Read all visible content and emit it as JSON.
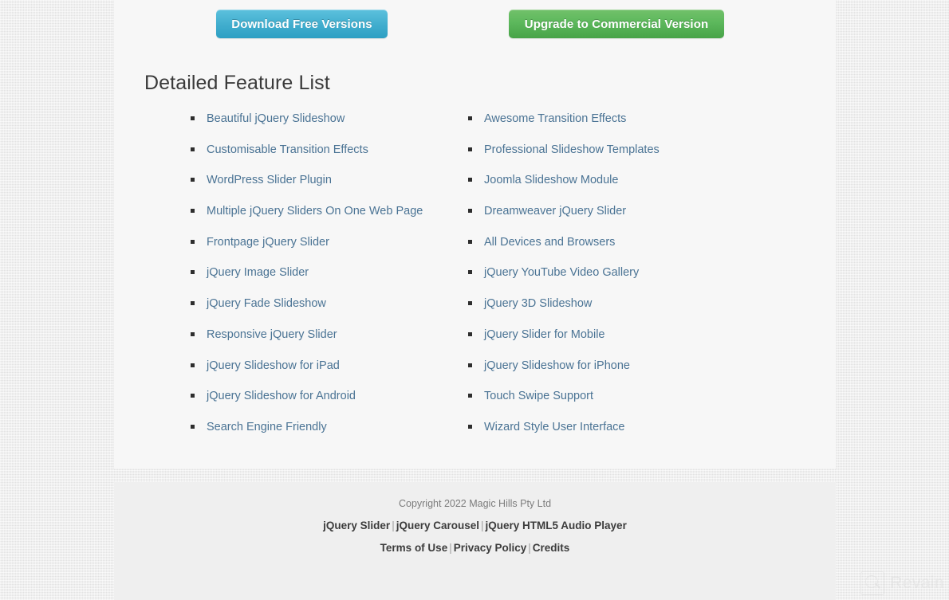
{
  "buttons": {
    "download": {
      "label": "Download Free Versions",
      "color": "#45b0d0"
    },
    "upgrade": {
      "label": "Upgrade to Commercial Version",
      "color": "#5cb85c"
    }
  },
  "section": {
    "title": "Detailed Feature List",
    "link_color": "#4a7394"
  },
  "features": {
    "left_column": [
      "Beautiful jQuery Slideshow",
      "Customisable Transition Effects",
      "WordPress Slider Plugin",
      "Multiple jQuery Sliders On One Web Page",
      "Frontpage jQuery Slider",
      "jQuery Image Slider",
      "jQuery Fade Slideshow",
      "Responsive jQuery Slider",
      "jQuery Slideshow for iPad",
      "jQuery Slideshow for Android",
      "Search Engine Friendly"
    ],
    "right_column": [
      "Awesome Transition Effects",
      "Professional Slideshow Templates",
      "Joomla Slideshow Module",
      "Dreamweaver jQuery Slider",
      "All Devices and Browsers",
      "jQuery YouTube Video Gallery",
      "jQuery 3D Slideshow",
      "jQuery Slider for Mobile",
      "jQuery Slideshow for iPhone",
      "Touch Swipe Support",
      "Wizard Style User Interface"
    ]
  },
  "footer": {
    "copyright": "Copyright 2022 Magic Hills Pty Ltd",
    "product_links": [
      "jQuery Slider",
      "jQuery Carousel",
      "jQuery HTML5 Audio Player"
    ],
    "legal_links": [
      "Terms of Use",
      "Privacy Policy",
      "Credits"
    ],
    "separator": "|"
  },
  "watermark": {
    "text": "Revain",
    "icon": "revain-logo-icon"
  }
}
